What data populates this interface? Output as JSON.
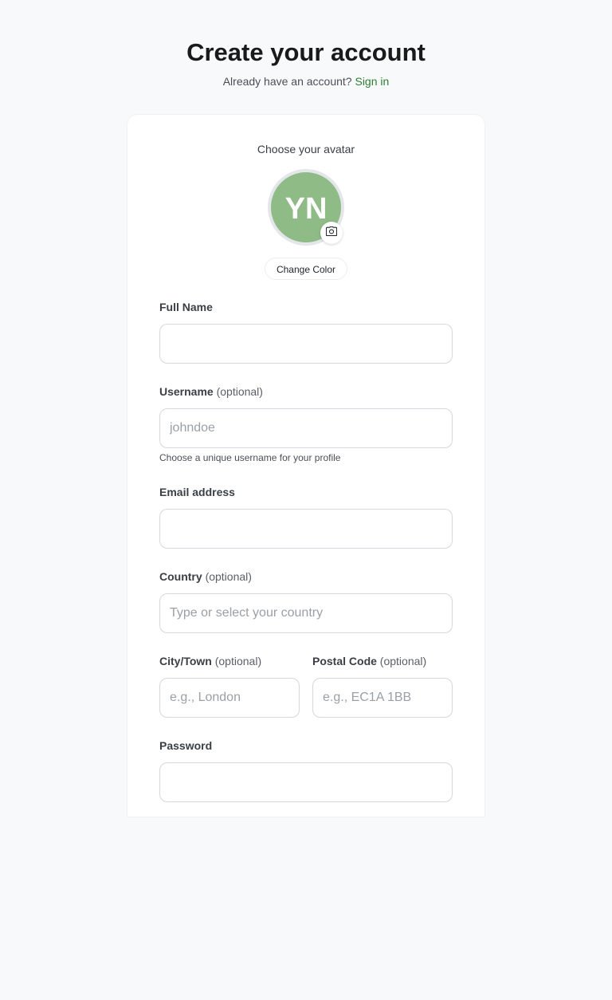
{
  "header": {
    "title": "Create your account",
    "subtitle_prefix": "Already have an account?",
    "sign_in_link": "Sign in"
  },
  "avatar": {
    "heading": "Choose your avatar",
    "initials": "YN",
    "color": "#8fbb87",
    "camera_icon": "camera-icon",
    "change_color_label": "Change Color"
  },
  "form": {
    "full_name": {
      "label": "Full Name",
      "value": "",
      "placeholder": ""
    },
    "username": {
      "label": "Username",
      "optional": "(optional)",
      "value": "",
      "placeholder": "johndoe",
      "helper": "Choose a unique username for your profile"
    },
    "email": {
      "label": "Email address",
      "value": "",
      "placeholder": ""
    },
    "country": {
      "label": "Country",
      "optional": "(optional)",
      "value": "",
      "placeholder": "Type or select your country"
    },
    "city": {
      "label": "City/Town",
      "optional": "(optional)",
      "value": "",
      "placeholder": "e.g., London"
    },
    "postal": {
      "label": "Postal Code",
      "optional": "(optional)",
      "value": "",
      "placeholder": "e.g., EC1A 1BB"
    },
    "password": {
      "label": "Password",
      "value": "",
      "placeholder": ""
    }
  },
  "colors": {
    "accent": "#2e7d32",
    "background": "#f8f9fa",
    "card": "#ffffff"
  }
}
